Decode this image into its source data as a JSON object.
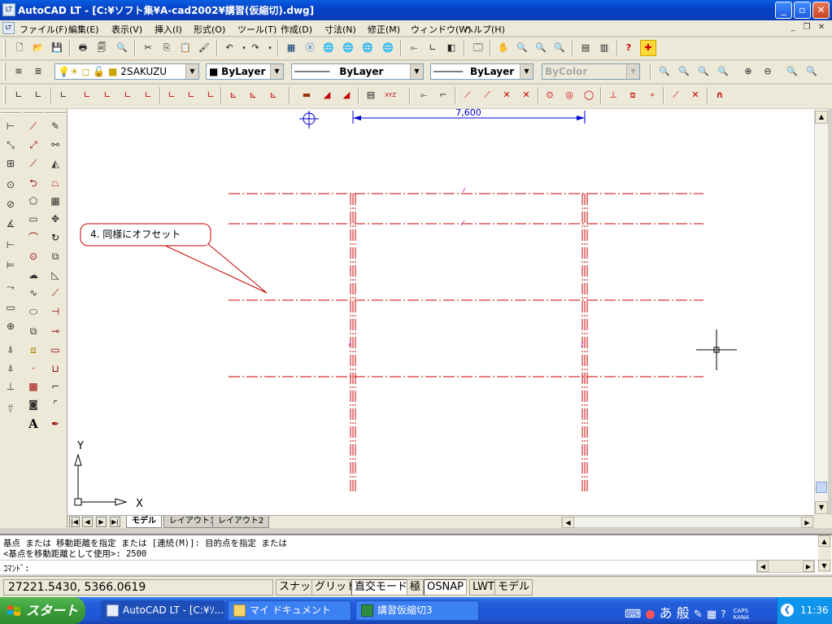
{
  "window": {
    "title": "AutoCAD LT - [C:¥ソフト集¥A-cad2002¥講習(仮縮切).dwg]"
  },
  "menu": [
    "ファイル(F)",
    "編集(E)",
    "表示(V)",
    "挿入(I)",
    "形式(O)",
    "ツール(T)",
    "作成(D)",
    "寸法(N)",
    "修正(M)",
    "ウィンドウ(W)",
    "ヘルプ(H)"
  ],
  "layer_toolbar": {
    "layer_name": "2SAKUZU",
    "color": "ByLayer",
    "linetype": "ByLayer",
    "lineweight": "ByLayer",
    "plotstyle": "ByColor"
  },
  "drawing": {
    "dimension_text": "7,600",
    "callout_text": "4. 同様にオフセット",
    "ucs_x_label": "X",
    "ucs_y_label": "Y",
    "line_color": "#cc0000",
    "dim_color": "#0000cc"
  },
  "tabs": {
    "items": [
      "モデル",
      "レイアウト1",
      "レイアウト2"
    ],
    "active": "モデル"
  },
  "command": {
    "history1": "基点 または 移動距離を指定 または [連続(M)]: 目的点を指定 または",
    "history2": "<基点を移動距離として使用>: 2500",
    "prompt": "ｺﾏﾝﾄﾞ:"
  },
  "status": {
    "coords": "27221.5430, 5366.0619",
    "panes": [
      {
        "label": "スナップ",
        "on": false
      },
      {
        "label": "グリッド",
        "on": false
      },
      {
        "label": "直交モード",
        "on": true
      },
      {
        "label": "極",
        "on": false
      },
      {
        "label": "OSNAP",
        "on": true
      },
      {
        "label": "LWT",
        "on": false
      },
      {
        "label": "モデル",
        "on": false
      }
    ]
  },
  "taskbar": {
    "start": "スタート",
    "tasks": [
      "AutoCAD LT - [C:¥ｿ...",
      "マイ ドキュメント",
      "講習仮縮切3"
    ],
    "ime": "あ 般",
    "caps": "CAPS",
    "kana": "KANA",
    "clock": "11:36"
  }
}
